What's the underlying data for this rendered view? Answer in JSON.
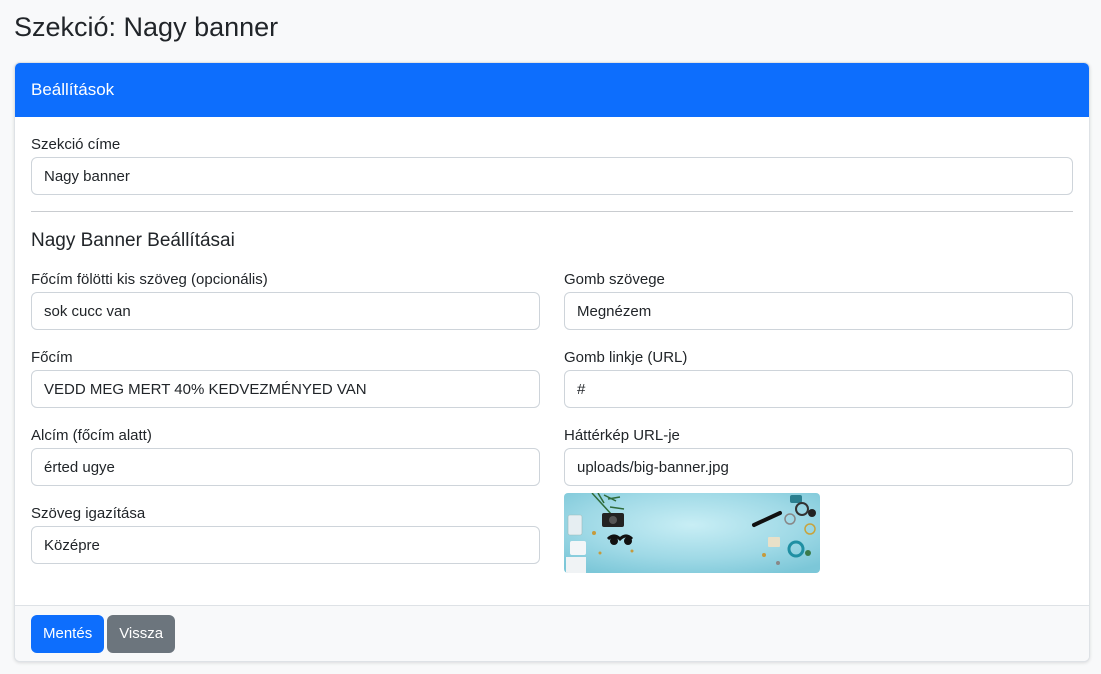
{
  "page": {
    "title": "Szekció: Nagy banner"
  },
  "card": {
    "header": "Beállítások"
  },
  "section_title": {
    "label": "Szekció címe",
    "value": "Nagy banner"
  },
  "banner_settings": {
    "heading": "Nagy Banner Beállításai",
    "small_text": {
      "label": "Főcím fölötti kis szöveg (opcionális)",
      "value": "sok cucc van"
    },
    "main_title": {
      "label": "Főcím",
      "value": "VEDD MEG MERT 40% KEDVEZMÉNYED VAN"
    },
    "subtitle": {
      "label": "Alcím (főcím alatt)",
      "value": "érted ugye"
    },
    "alignment": {
      "label": "Szöveg igazítása",
      "value": "Középre"
    },
    "button_text": {
      "label": "Gomb szövege",
      "value": "Megnézem"
    },
    "button_link": {
      "label": "Gomb linkje (URL)",
      "value": "#"
    },
    "background_url": {
      "label": "Háttérkép URL-je",
      "value": "uploads/big-banner.jpg"
    }
  },
  "footer": {
    "save_label": "Mentés",
    "back_label": "Vissza"
  },
  "colors": {
    "primary": "#0d6efd",
    "secondary": "#6c757d",
    "preview_bg": "#9fd9e6"
  }
}
